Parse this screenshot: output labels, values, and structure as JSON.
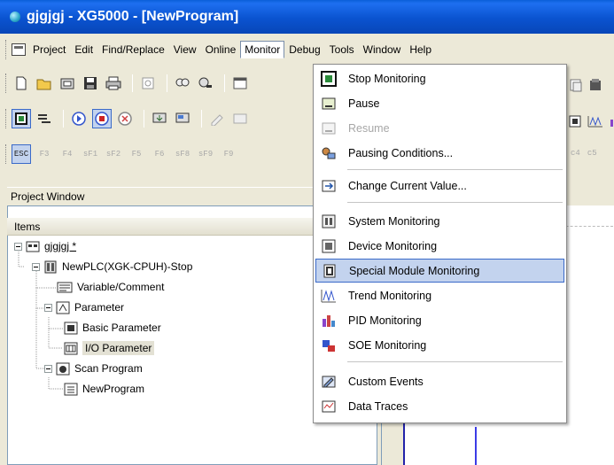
{
  "window": {
    "title": "gjgjgj - XG5000 - [NewProgram]"
  },
  "menubar": {
    "items": [
      {
        "label": "Project"
      },
      {
        "label": "Edit"
      },
      {
        "label": "Find/Replace"
      },
      {
        "label": "View"
      },
      {
        "label": "Online"
      },
      {
        "label": "Monitor"
      },
      {
        "label": "Debug"
      },
      {
        "label": "Tools"
      },
      {
        "label": "Window"
      },
      {
        "label": "Help"
      }
    ]
  },
  "monitor_menu": {
    "items": [
      {
        "label": "Stop Monitoring",
        "icon": "stop-monitoring-icon",
        "enabled": true
      },
      {
        "label": "Pause",
        "icon": "pause-icon",
        "enabled": true
      },
      {
        "label": "Resume",
        "icon": "resume-icon",
        "enabled": false
      },
      {
        "label": "Pausing Conditions...",
        "icon": "pausing-conditions-icon",
        "enabled": true
      },
      {
        "label": "Change Current Value...",
        "icon": "change-value-icon",
        "enabled": true
      },
      {
        "label": "System Monitoring",
        "icon": "system-monitoring-icon",
        "enabled": true
      },
      {
        "label": "Device Monitoring",
        "icon": "device-monitoring-icon",
        "enabled": true
      },
      {
        "label": "Special Module Monitoring",
        "icon": "special-module-icon",
        "enabled": true,
        "highlighted": true
      },
      {
        "label": "Trend Monitoring",
        "icon": "trend-monitoring-icon",
        "enabled": true
      },
      {
        "label": "PID Monitoring",
        "icon": "pid-monitoring-icon",
        "enabled": true
      },
      {
        "label": "SOE Monitoring",
        "icon": "soe-monitoring-icon",
        "enabled": true
      },
      {
        "label": "Custom Events",
        "icon": "custom-events-icon",
        "enabled": true
      },
      {
        "label": "Data Traces",
        "icon": "data-traces-icon",
        "enabled": true
      }
    ]
  },
  "project_window": {
    "caption": "Project Window",
    "column_header": "Items",
    "tree": [
      {
        "label": "gjgjgj *"
      },
      {
        "label": "NewPLC(XGK-CPUH)-Stop"
      },
      {
        "label": "Variable/Comment"
      },
      {
        "label": "Parameter"
      },
      {
        "label": "Basic Parameter"
      },
      {
        "label": "I/O Parameter"
      },
      {
        "label": "Scan Program"
      },
      {
        "label": "NewProgram"
      }
    ]
  },
  "toolbar3": {
    "keys": [
      "ESC",
      "F3",
      "F4",
      "sF1",
      "sF2",
      "F5",
      "F6",
      "sF8",
      "sF9",
      "F9"
    ],
    "right_keys": [
      "c4",
      "c5"
    ]
  },
  "colors": {
    "titlebar": "#0a53d0",
    "menu_highlight": "#c3d3ee",
    "menu_highlight_border": "#3a6ac9",
    "disabled_text": "#a7a7a7"
  }
}
